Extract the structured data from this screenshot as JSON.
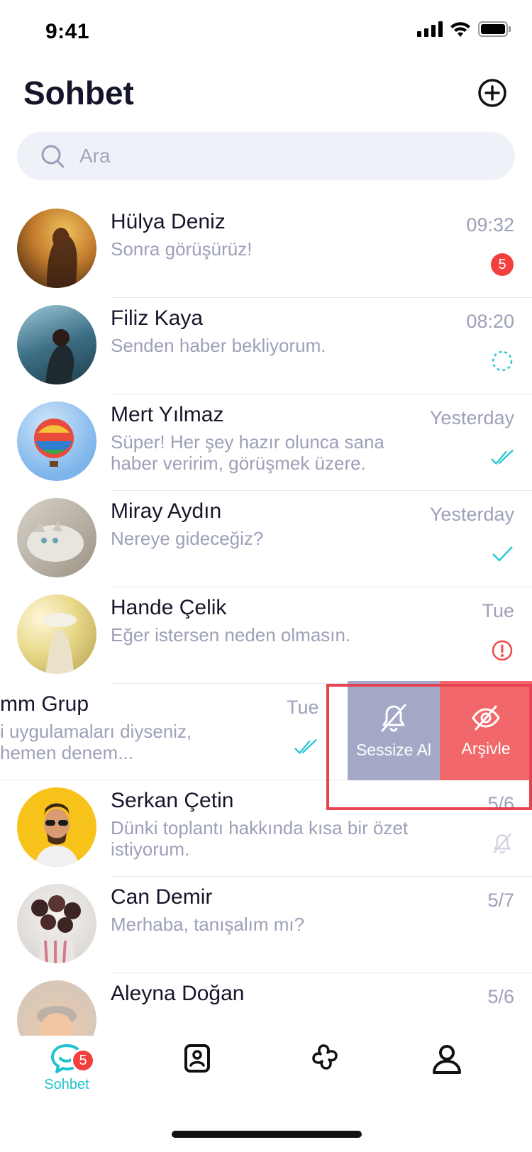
{
  "status_bar": {
    "time": "9:41"
  },
  "header": {
    "title": "Sohbet"
  },
  "search": {
    "placeholder": "Ara"
  },
  "chats": [
    {
      "name": "Hülya Deniz",
      "message": "Sonra görüşürüz!",
      "time": "09:32",
      "status": "unread",
      "unread_count": "5"
    },
    {
      "name": "Filiz Kaya",
      "message": "Senden haber bekliyorum.",
      "time": "08:20",
      "status": "sending"
    },
    {
      "name": "Mert Yılmaz",
      "message": "Süper! Her şey hazır olunca sana haber veririm, görüşmek üzere.",
      "time": "Yesterday",
      "status": "read"
    },
    {
      "name": "Miray Aydın",
      "message": "Nereye gideceğiz?",
      "time": "Yesterday",
      "status": "sent"
    },
    {
      "name": "Hande Çelik",
      "message": "Eğer istersen neden olmasın.",
      "time": "Tue",
      "status": "error"
    },
    {
      "name": "mm Grup",
      "message": "i uygulamaları diyseniz, hemen denem...",
      "time": "Tue",
      "status": "read"
    },
    {
      "name": "Serkan Çetin",
      "message": "Dünki toplantı hakkında kısa bir özet istiyorum.",
      "time": "5/6",
      "status": "muted"
    },
    {
      "name": "Can Demir",
      "message": "Merhaba, tanışalım mı?",
      "time": "5/7",
      "status": "none"
    },
    {
      "name": "Aleyna Doğan",
      "message": "",
      "time": "5/6",
      "status": "none"
    }
  ],
  "swipe_actions": {
    "mute_label": "Sessize Al",
    "archive_label": "Arşivle"
  },
  "tabbar": {
    "chat_label": "Sohbet",
    "chat_badge": "5"
  },
  "colors": {
    "accent": "#1ec3d0",
    "badge": "#f3403f",
    "mute": "#a3a8c6",
    "archive": "#f2686a",
    "highlight": "#e5434f"
  }
}
